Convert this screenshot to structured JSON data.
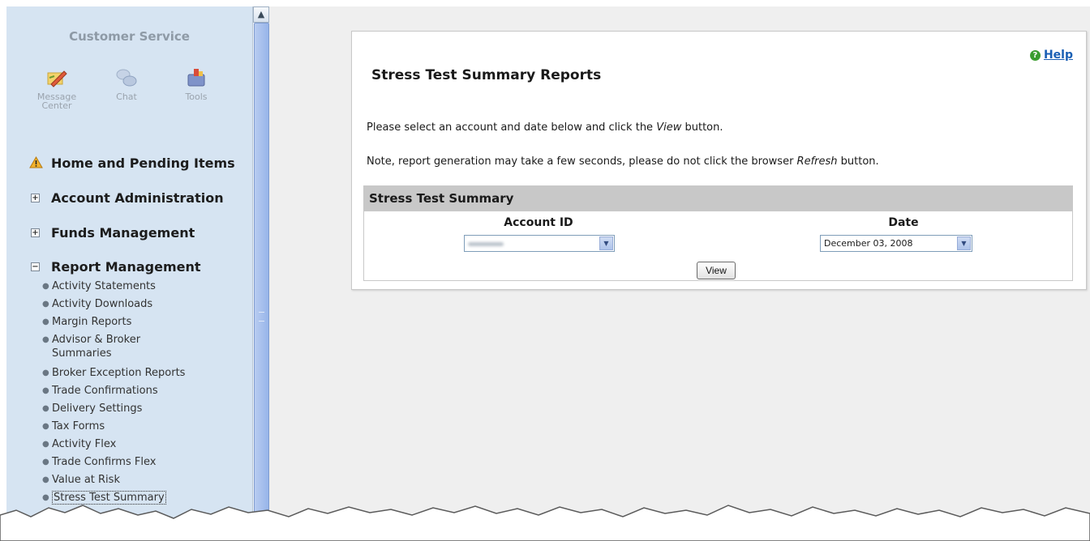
{
  "sidebar": {
    "title": "Customer Service",
    "quick_links": [
      {
        "label_line1": "Message",
        "label_line2": "Center",
        "icon": "pencil-note-icon"
      },
      {
        "label_line1": "Chat",
        "label_line2": "",
        "icon": "chat-bubbles-icon"
      },
      {
        "label_line1": "Tools",
        "label_line2": "",
        "icon": "toolbox-icon"
      }
    ],
    "nav": {
      "home": "Home and Pending Items",
      "account_admin": "Account Administration",
      "funds": "Funds Management",
      "report": "Report Management"
    },
    "report_items": [
      "Activity Statements",
      "Activity Downloads",
      "Margin Reports",
      "Advisor & Broker",
      "Summaries",
      "Broker Exception Reports",
      "Trade Confirmations",
      "Delivery Settings",
      "Tax Forms",
      "Activity Flex",
      "Trade Confirms Flex",
      "Value at Risk",
      "Stress Test Summary"
    ]
  },
  "main": {
    "title": "Stress Test Summary Reports",
    "help": "Help",
    "instr1_a": "Please select an account and date below and click the ",
    "instr1_em": "View",
    "instr1_b": " button.",
    "instr2_a": "Note, report generation may take a few seconds, please do not click the browser ",
    "instr2_em": "Refresh",
    "instr2_b": " button.",
    "section_title": "Stress Test Summary",
    "account_label": "Account ID",
    "date_label": "Date",
    "date_value": "December 03, 2008",
    "view_button": "View"
  },
  "colors": {
    "sidebar_bg": "#d6e4f2",
    "panel_header_bg": "#c8c8c8",
    "link": "#1a5fb4",
    "help_icon": "#3a9c2f"
  }
}
